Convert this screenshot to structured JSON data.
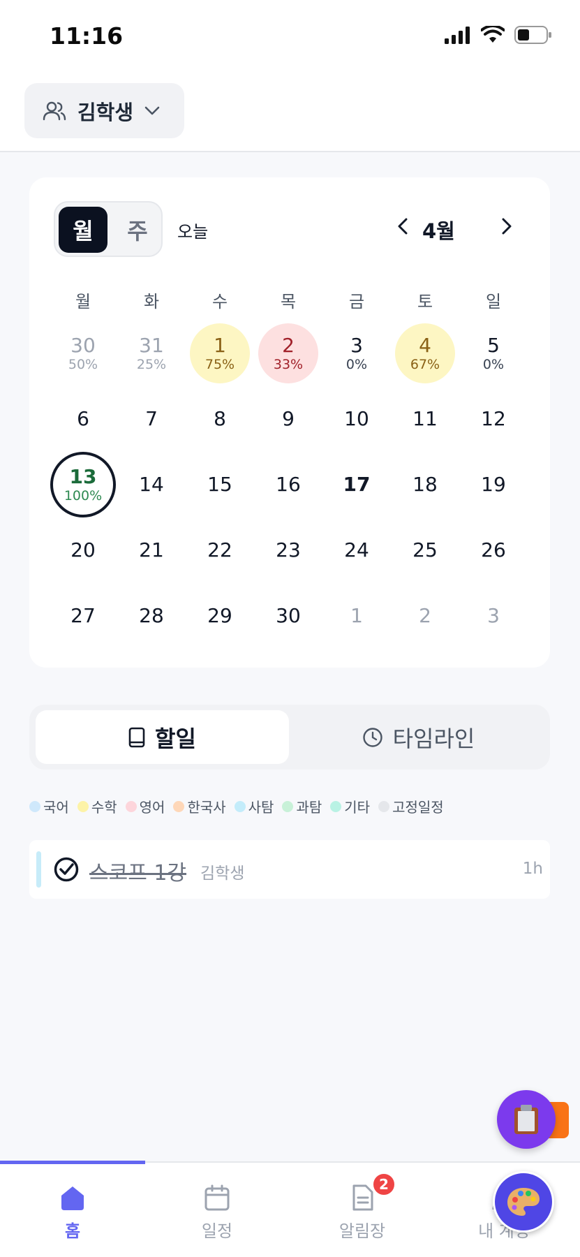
{
  "status_bar": {
    "time": "11:16"
  },
  "header": {
    "student_name": "김학생"
  },
  "calendar": {
    "view_month": "월",
    "view_week": "주",
    "today_label": "오늘",
    "month_label": "4월",
    "weekdays": [
      "월",
      "화",
      "수",
      "목",
      "금",
      "토",
      "일"
    ],
    "days": [
      {
        "num": "30",
        "pct": "50%",
        "style": "other"
      },
      {
        "num": "31",
        "pct": "25%",
        "style": "other"
      },
      {
        "num": "1",
        "pct": "75%",
        "style": "yellow"
      },
      {
        "num": "2",
        "pct": "33%",
        "style": "pink"
      },
      {
        "num": "3",
        "pct": "0%",
        "style": "plain"
      },
      {
        "num": "4",
        "pct": "67%",
        "style": "yellow"
      },
      {
        "num": "5",
        "pct": "0%",
        "style": "plain"
      },
      {
        "num": "6",
        "pct": "",
        "style": "plain"
      },
      {
        "num": "7",
        "pct": "",
        "style": "plain"
      },
      {
        "num": "8",
        "pct": "",
        "style": "plain"
      },
      {
        "num": "9",
        "pct": "",
        "style": "plain"
      },
      {
        "num": "10",
        "pct": "",
        "style": "plain"
      },
      {
        "num": "11",
        "pct": "",
        "style": "plain"
      },
      {
        "num": "12",
        "pct": "",
        "style": "plain"
      },
      {
        "num": "13",
        "pct": "100%",
        "style": "selected"
      },
      {
        "num": "14",
        "pct": "",
        "style": "plain"
      },
      {
        "num": "15",
        "pct": "",
        "style": "plain"
      },
      {
        "num": "16",
        "pct": "",
        "style": "plain"
      },
      {
        "num": "17",
        "pct": "",
        "style": "today"
      },
      {
        "num": "18",
        "pct": "",
        "style": "plain"
      },
      {
        "num": "19",
        "pct": "",
        "style": "plain"
      },
      {
        "num": "20",
        "pct": "",
        "style": "plain"
      },
      {
        "num": "21",
        "pct": "",
        "style": "plain"
      },
      {
        "num": "22",
        "pct": "",
        "style": "plain"
      },
      {
        "num": "23",
        "pct": "",
        "style": "plain"
      },
      {
        "num": "24",
        "pct": "",
        "style": "plain"
      },
      {
        "num": "25",
        "pct": "",
        "style": "plain"
      },
      {
        "num": "26",
        "pct": "",
        "style": "plain"
      },
      {
        "num": "27",
        "pct": "",
        "style": "plain"
      },
      {
        "num": "28",
        "pct": "",
        "style": "plain"
      },
      {
        "num": "29",
        "pct": "",
        "style": "plain"
      },
      {
        "num": "30",
        "pct": "",
        "style": "plain"
      },
      {
        "num": "1",
        "pct": "",
        "style": "next"
      },
      {
        "num": "2",
        "pct": "",
        "style": "next"
      },
      {
        "num": "3",
        "pct": "",
        "style": "next"
      }
    ]
  },
  "view_tabs": {
    "todo": "할일",
    "timeline": "타임라인"
  },
  "legend": [
    {
      "label": "국어",
      "color": "#cfe8fb"
    },
    {
      "label": "수학",
      "color": "#fdf3a8"
    },
    {
      "label": "영어",
      "color": "#fdd5db"
    },
    {
      "label": "한국사",
      "color": "#fed7b8"
    },
    {
      "label": "사탐",
      "color": "#c3ecfa"
    },
    {
      "label": "과탐",
      "color": "#c8f1d8"
    },
    {
      "label": "기타",
      "color": "#b9f2e4"
    },
    {
      "label": "고정일정",
      "color": "#e5e7eb"
    }
  ],
  "task": {
    "title": "스코프 1강",
    "owner": "김학생",
    "duration": "1h"
  },
  "bottom_nav": {
    "home": "홈",
    "schedule": "일정",
    "notice": "알림장",
    "notice_badge": "2",
    "my": "내 계정"
  },
  "colors": {
    "accent": "#6366f1",
    "fab_purple": "#7c3aed",
    "orange": "#f97316"
  }
}
